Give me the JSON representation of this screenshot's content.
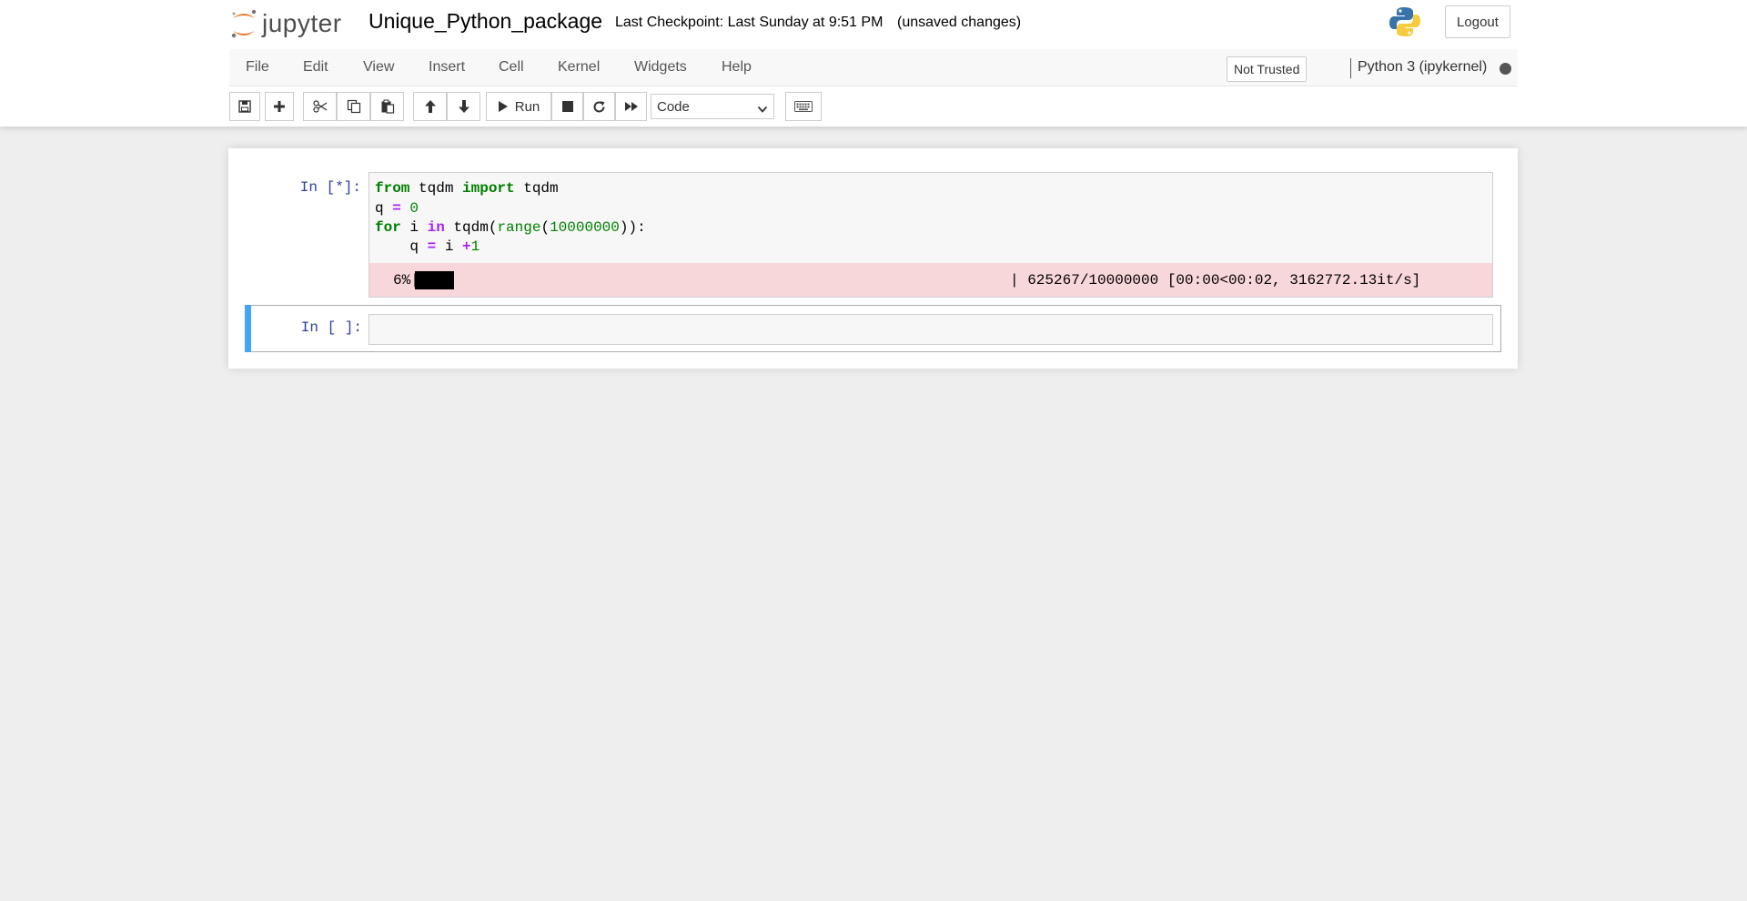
{
  "header": {
    "logo_text": "jupyter",
    "notebook_title": "Unique_Python_package",
    "checkpoint": "Last Checkpoint: Last Sunday at 9:51 PM",
    "unsaved": "(unsaved changes)",
    "logout_label": "Logout"
  },
  "menubar": {
    "items": [
      {
        "label": "File"
      },
      {
        "label": "Edit"
      },
      {
        "label": "View"
      },
      {
        "label": "Insert"
      },
      {
        "label": "Cell"
      },
      {
        "label": "Kernel"
      },
      {
        "label": "Widgets"
      },
      {
        "label": "Help"
      }
    ],
    "trust_status": "Not Trusted",
    "kernel_name": "Python 3 (ipykernel)",
    "kernel_state": "busy"
  },
  "toolbar": {
    "icons": [
      "save-icon",
      "plus-icon",
      "cut-icon",
      "copy-icon",
      "paste-icon",
      "arrow-up-icon",
      "arrow-down-icon",
      "play-icon",
      "stop-icon",
      "restart-icon",
      "fast-forward-icon",
      "keyboard-icon"
    ],
    "run_label": "Run",
    "cell_type": "Code"
  },
  "cells": [
    {
      "prompt": "In [*]:",
      "code": [
        "from tqdm import tqdm",
        "q = 0",
        "for i in tqdm(range(10000000)):",
        "    q = i +1"
      ],
      "output": {
        "percent_text": "6%|",
        "progress_fraction": 0.0625,
        "stats": "| 625267/10000000 [00:00<00:02, 3162772.13it/s]"
      }
    },
    {
      "prompt": "In [ ]:",
      "code": []
    }
  ],
  "colors": {
    "prompt": "#303f9f",
    "keyword": "#008000",
    "operator": "#aa22ff",
    "stderr_bg": "#f8d7da",
    "selected_cell_bar": "#42a5f5",
    "jupyter_orange": "#f37726"
  }
}
